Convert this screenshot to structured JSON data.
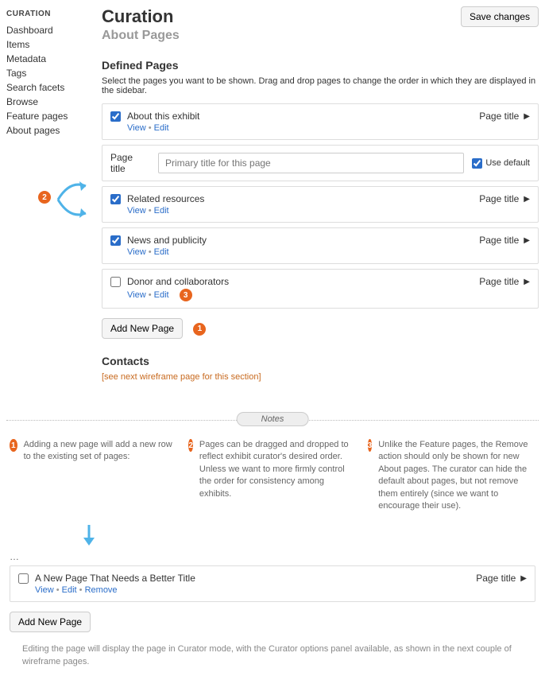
{
  "sidebar": {
    "title": "CURATION",
    "items": [
      "Dashboard",
      "Items",
      "Metadata",
      "Tags",
      "Search facets",
      "Browse",
      "Feature pages",
      "About pages"
    ]
  },
  "header": {
    "title": "Curation",
    "subtitle": "About Pages",
    "save_label": "Save changes"
  },
  "defined": {
    "title": "Defined Pages",
    "help": "Select the pages you want to be shown. Drag and drop pages to change the order in which they are displayed in the sidebar.",
    "right_label": "Page title",
    "view_label": "View",
    "edit_label": "Edit",
    "remove_label": "Remove",
    "pages": [
      {
        "title": "About this exhibit",
        "checked": true
      },
      {
        "title": "Related resources",
        "checked": true
      },
      {
        "title": "News and publicity",
        "checked": true
      },
      {
        "title": "Donor and collaborators",
        "checked": false
      }
    ],
    "settings": {
      "label": "Page title",
      "placeholder": "Primary title for this page",
      "use_default_label": "Use default"
    },
    "add_label": "Add New Page"
  },
  "contacts": {
    "title": "Contacts",
    "note": "[see next wireframe page for this section]"
  },
  "notes": {
    "heading": "Notes",
    "items": [
      "Adding a new page will add a new row to the existing set of pages:",
      "Pages can be dragged and dropped to reflect exhibit curator's desired order. Unless we want to more firmly control the order for consistency among exhibits.",
      "Unlike the Feature pages, the Remove action should only be shown for new About pages. The curator can hide the default about pages, but not remove them entirely (since we want to encourage their use)."
    ]
  },
  "example": {
    "new_page_title": "A New Page That Needs a Better Title",
    "add_label": "Add New Page"
  },
  "footer_note": "Editing the page will display the page in Curator mode, with the Curator options panel available, as shown in the next couple of wireframe pages."
}
